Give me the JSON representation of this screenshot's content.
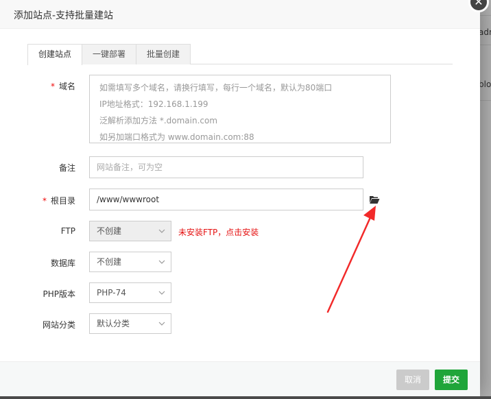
{
  "dialog": {
    "title": "添加站点-支持批量建站",
    "close_label": "✕"
  },
  "tabs": [
    {
      "label": "创建站点",
      "active": true
    },
    {
      "label": "一键部署",
      "active": false
    },
    {
      "label": "批量创建",
      "active": false
    }
  ],
  "form": {
    "domain": {
      "required_mark": "*",
      "label": "域名",
      "placeholder_lines": [
        "如需填写多个域名，请换行填写，每行一个域名，默认为80端口",
        "IP地址格式：192.168.1.199",
        "泛解析添加方法 *.domain.com",
        "如另加端口格式为 www.domain.com:88"
      ]
    },
    "remark": {
      "label": "备注",
      "placeholder": "网站备注，可为空"
    },
    "root_dir": {
      "required_mark": "*",
      "label": "根目录",
      "value": "/www/wwwroot"
    },
    "ftp": {
      "label": "FTP",
      "selected": "不创建",
      "warning": "未安装FTP，点击安装"
    },
    "database": {
      "label": "数据库",
      "selected": "不创建"
    },
    "php": {
      "label": "PHP版本",
      "selected": "PHP-74"
    },
    "category": {
      "label": "网站分类",
      "selected": "默认分类"
    }
  },
  "footer": {
    "cancel_label": "取消",
    "submit_label": "提交"
  },
  "background": {
    "fragments": [
      "adr",
      "blo"
    ]
  },
  "colors": {
    "accent_green": "#20a53a",
    "warning_red": "#e51111",
    "required_red": "#ef0808",
    "annotation_arrow": "#f22a2a"
  },
  "icons": {
    "folder": "folder-open-icon",
    "close": "close-icon",
    "chevron": "chevron-down-icon"
  }
}
